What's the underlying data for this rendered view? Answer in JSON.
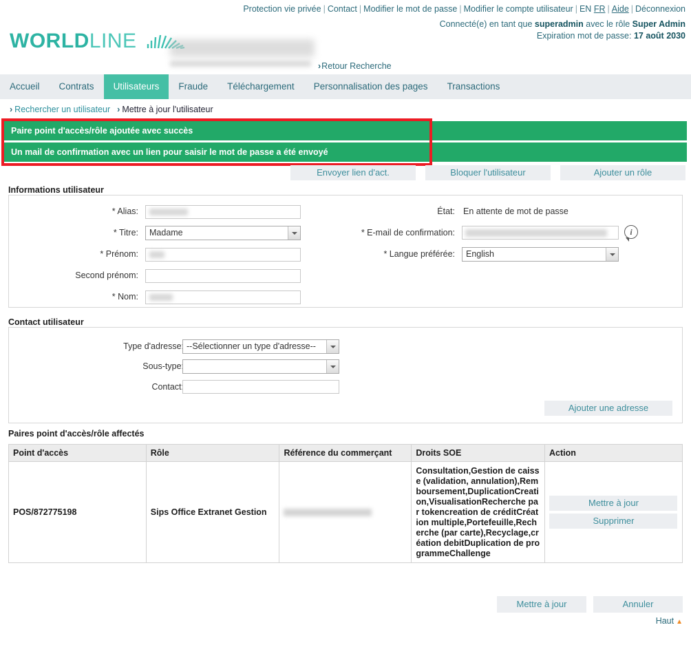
{
  "header": {
    "top_links": [
      "Protection vie privée",
      "Contact",
      "Modifier le mot de passe",
      "Modifier le compte utilisateur"
    ],
    "lang_en": "EN",
    "lang_fr": "FR",
    "help": "Aide",
    "logout": "Déconnexion",
    "session_prefix": "Connecté(e) en tant que",
    "session_user": "superadmin",
    "session_middle": "avec le rôle",
    "session_role": "Super Admin",
    "password_expiry_label": "Expiration mot de passe:",
    "password_expiry_value": "17 août 2030",
    "logo_bold": "WORLD",
    "logo_light": "LINE",
    "back_to_search": "Retour Recherche"
  },
  "nav": {
    "tabs": [
      {
        "label": "Accueil",
        "active": false
      },
      {
        "label": "Contrats",
        "active": false
      },
      {
        "label": "Utilisateurs",
        "active": true
      },
      {
        "label": "Fraude",
        "active": false
      },
      {
        "label": "Téléchargement",
        "active": false
      },
      {
        "label": "Personnalisation des pages",
        "active": false
      },
      {
        "label": "Transactions",
        "active": false
      }
    ]
  },
  "breadcrumb": {
    "item1": "Rechercher un utilisateur",
    "item2": "Mettre à jour l'utilisateur"
  },
  "alerts": [
    "Paire point d'accès/rôle ajoutée avec succès",
    "Un mail de confirmation avec un lien pour saisir le mot de passe a été envoyé"
  ],
  "action_buttons": {
    "send_activation_link": "Envoyer lien d'act.",
    "block_user": "Bloquer l'utilisateur",
    "add_role": "Ajouter un rôle"
  },
  "user_info": {
    "title": "Informations utilisateur",
    "alias_label": "* Alias:",
    "alias_value": "",
    "title_label": "* Titre:",
    "title_value": "Madame",
    "firstname_label": "* Prénom:",
    "firstname_value": "",
    "middlename_label": "Second prénom:",
    "middlename_value": "",
    "lastname_label": "* Nom:",
    "lastname_value": "",
    "state_label": "État:",
    "state_value": "En attente de mot de passe",
    "email_label": "* E-mail de confirmation:",
    "email_value": "",
    "language_label": "* Langue préférée:",
    "language_value": "English"
  },
  "contact": {
    "title": "Contact utilisateur",
    "address_type_label": "Type d'adresse:",
    "address_type_value": "--Sélectionner un type d'adresse--",
    "subtype_label": "Sous-type:",
    "subtype_value": "",
    "contact_label": "Contact:",
    "contact_value": "",
    "add_address_button": "Ajouter une adresse"
  },
  "roles_table": {
    "title": "Paires point d'accès/rôle affectés",
    "columns": [
      "Point d'accès",
      "Rôle",
      "Référence du commerçant",
      "Droits SOE",
      "Action"
    ],
    "rows": [
      {
        "access_point": "POS/872775198",
        "role": "Sips Office Extranet Gestion",
        "merchant_reference": "",
        "soe_rights": "Consultation,Gestion de caisse (validation, annulation),Remboursement,DuplicationCreation,VisualisationRecherche par tokencreation de créditCréation multiple,Portefeuille,Recherche (par carte),Recyclage,création debitDuplication de programmeChallenge",
        "update_button": "Mettre à jour",
        "delete_button": "Supprimer"
      }
    ]
  },
  "footer": {
    "update_button": "Mettre à jour",
    "cancel_button": "Annuler",
    "top_link": "Haut"
  }
}
